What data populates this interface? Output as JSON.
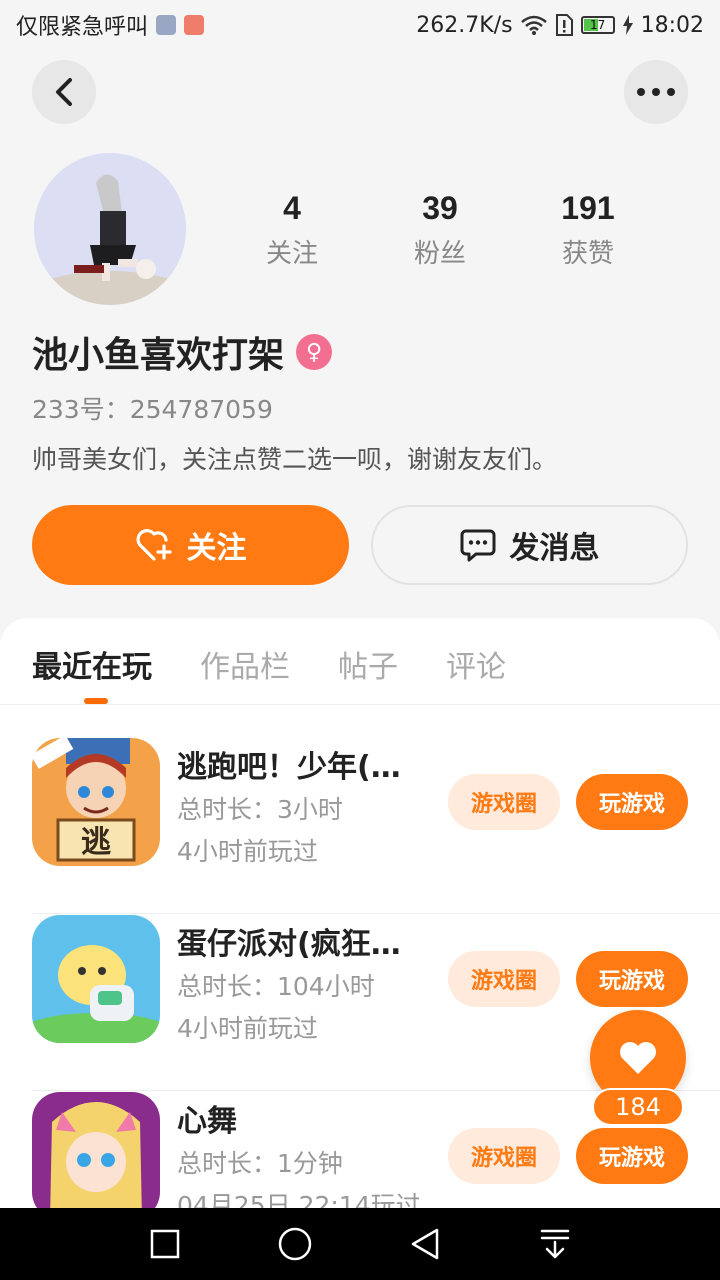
{
  "status_bar": {
    "carrier": "仅限紧急呼叫",
    "speed": "262.7K/s",
    "battery": "17",
    "time": "18:02"
  },
  "profile": {
    "stats": [
      {
        "num": "4",
        "label": "关注"
      },
      {
        "num": "39",
        "label": "粉丝"
      },
      {
        "num": "191",
        "label": "获赞"
      }
    ],
    "name": "池小鱼喜欢打架",
    "gender_symbol": "♀",
    "uid": "233号：254787059",
    "bio": "帅哥美女们，关注点赞二选一呗，谢谢友友们。",
    "follow_label": "关注",
    "message_label": "发消息"
  },
  "tabs": [
    "最近在玩",
    "作品栏",
    "帖子",
    "评论"
  ],
  "games": [
    {
      "title": "逃跑吧！少年(…",
      "time": "总时长：3小时",
      "last": "4小时前玩过",
      "circle": "游戏圈",
      "play": "玩游戏"
    },
    {
      "title": "蛋仔派对(疯狂…",
      "time": "总时长：104小时",
      "last": "4小时前玩过",
      "circle": "游戏圈",
      "play": "玩游戏"
    },
    {
      "title": "心舞",
      "time": "总时长：1分钟",
      "last": "04月25日 22:14玩过",
      "circle": "游戏圈",
      "play": "玩游戏"
    }
  ],
  "like_count": "184",
  "icons": [
    "back-icon",
    "more-icon",
    "heart-plus-icon",
    "chat-icon",
    "heart-icon",
    "square-icon",
    "circle-icon",
    "triangle-back-icon",
    "download-icon"
  ],
  "colors": {
    "accent": "#ff7a12"
  }
}
